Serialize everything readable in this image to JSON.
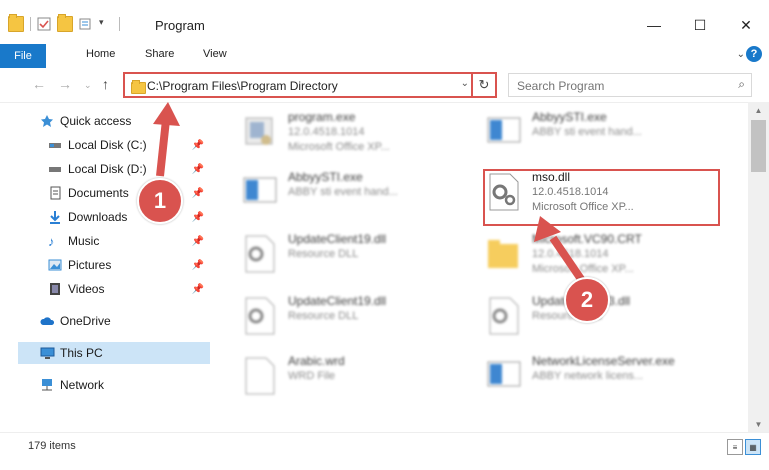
{
  "window": {
    "title": "Program",
    "minimize": "—",
    "maximize": "☐",
    "close": "✕"
  },
  "ribbon": {
    "tabs": [
      "File",
      "Home",
      "Share",
      "View"
    ],
    "help": "?",
    "expand": "⌄"
  },
  "address": {
    "path": "C:\\Program Files\\Program Directory",
    "dropdown": "⌄",
    "refresh": "↻"
  },
  "nav_buttons": {
    "back": "←",
    "forward": "→",
    "up_list": "⌄",
    "up": "↑"
  },
  "search": {
    "placeholder": "Search Program",
    "icon": "⌕"
  },
  "sidebar": {
    "quick_access": "Quick access",
    "items": [
      {
        "label": "Local Disk (C:)",
        "icon": "drive-icon"
      },
      {
        "label": "Local Disk (D:)",
        "icon": "drive-icon"
      },
      {
        "label": "Documents",
        "icon": "documents-icon"
      },
      {
        "label": "Downloads",
        "icon": "downloads-icon"
      },
      {
        "label": "Music",
        "icon": "music-icon"
      },
      {
        "label": "Pictures",
        "icon": "pictures-icon"
      },
      {
        "label": "Videos",
        "icon": "videos-icon"
      }
    ],
    "onedrive": "OneDrive",
    "this_pc": "This PC",
    "network": "Network"
  },
  "files": [
    {
      "name": "program.exe",
      "line2": "12.0.4518.1014",
      "line3": "Microsoft Office XP...",
      "type": "exe"
    },
    {
      "name": "AbbyySTI.exe",
      "line2": "ABBY sti event hand...",
      "line3": "",
      "type": "app"
    },
    {
      "name": "AbbyySTI.exe",
      "line2": "ABBY sti event hand...",
      "line3": "",
      "type": "app"
    },
    {
      "name": "mso.dll",
      "line2": "12.0.4518.1014",
      "line3": "Microsoft Office XP...",
      "type": "dll"
    },
    {
      "name": "UpdateClient19.dll",
      "line2": "Resource DLL",
      "line3": "",
      "type": "dll"
    },
    {
      "name": "Microsoft.VC90.CRT",
      "line2": "12.0.4518.1014",
      "line3": "Microsoft Office XP...",
      "type": "folder"
    },
    {
      "name": "UpdateClient19.dll",
      "line2": "Resource DLL",
      "line3": "",
      "type": "dll"
    },
    {
      "name": "UpdateClient63.dll",
      "line2": "Resource DLL",
      "line3": "",
      "type": "dll"
    },
    {
      "name": "Arabic.wrd",
      "line2": "WRD File",
      "line3": "",
      "type": "file"
    },
    {
      "name": "NetworkLicenseServer.exe",
      "line2": "ABBY network licens...",
      "line3": "",
      "type": "app"
    }
  ],
  "status": {
    "count": "179 items"
  },
  "annotations": [
    "1",
    "2"
  ],
  "colors": {
    "accent": "#1979ca",
    "highlight_red": "#d9534f",
    "selected": "#cce4f7"
  }
}
